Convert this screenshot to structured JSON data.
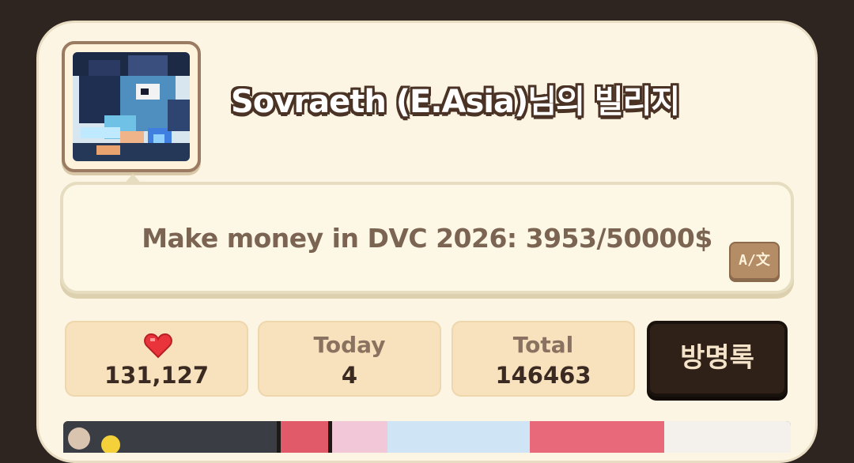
{
  "village": {
    "title": "Sovraeth (E.Asia)님의 빌리지",
    "message": "Make money in DVC 2026: 3953/50000$",
    "translate_label": "A/文"
  },
  "stats": {
    "likes": {
      "icon": "heart-icon",
      "value": "131,127"
    },
    "today": {
      "label": "Today",
      "value": "4"
    },
    "total": {
      "label": "Total",
      "value": "146463"
    }
  },
  "guestbook_label": "방명록",
  "colors": {
    "card_bg": "#fcf5e3",
    "stat_bg": "#f7e2bd",
    "guestbook_bg": "#2f2118",
    "heart": "#e8343a"
  }
}
